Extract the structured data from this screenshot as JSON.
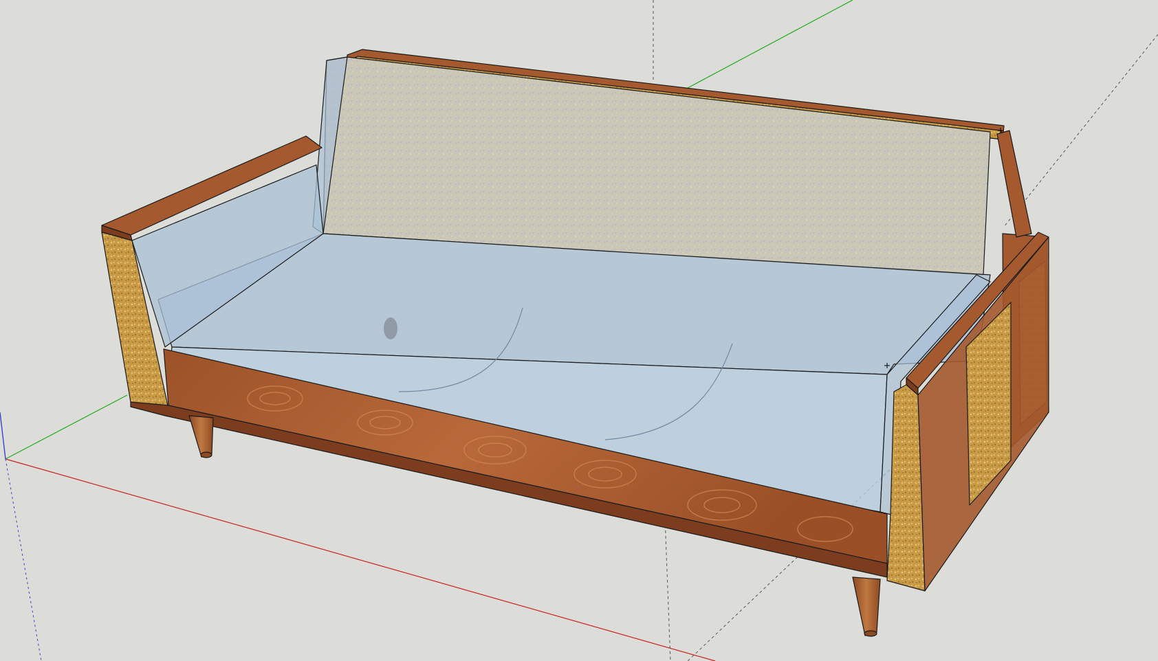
{
  "app": {
    "name": ""
  },
  "viewport": {
    "background": "#dcdcd8",
    "view": "perspective"
  },
  "axes": {
    "red_axis_color": "#cc2222",
    "green_axis_color": "#22aa22",
    "blue_axis_color": "#3344cc",
    "guide_color": "#555555"
  },
  "model": {
    "description_icon": "sofa-model-icon",
    "materials": {
      "wood_color": "#a4592e",
      "wood_dark": "#7b3d1e",
      "wood_grain": "#c97a45",
      "cork_color": "#c99a45",
      "cork_light": "#e3bf6f",
      "glass_color": "#a9c0d6",
      "fabric_color": "#c9c5b4",
      "leg_color": "#b06838",
      "edge_color": "#1a1a1a"
    }
  },
  "inference_points": [
    {
      "name": "endpoint-marker-back-top"
    },
    {
      "name": "endpoint-marker-seat-right"
    }
  ]
}
